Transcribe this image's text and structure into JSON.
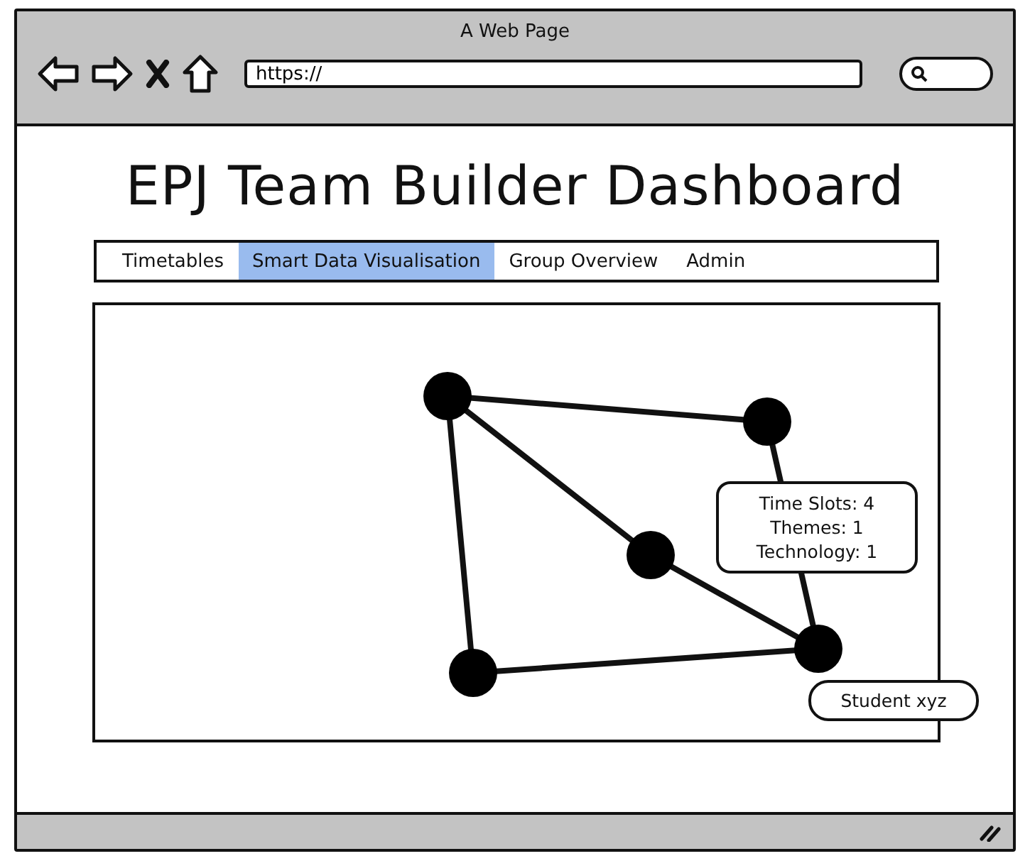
{
  "window": {
    "title": "A Web Page"
  },
  "address_bar": {
    "value": "https://"
  },
  "page": {
    "title": "EPJ Team Builder Dashboard"
  },
  "tabs": [
    {
      "label": "Timetables",
      "selected": false
    },
    {
      "label": "Smart Data Visualisation",
      "selected": true
    },
    {
      "label": "Group Overview",
      "selected": false
    },
    {
      "label": "Admin",
      "selected": false
    }
  ],
  "graph": {
    "callouts": [
      {
        "kind": "details",
        "lines": [
          "Time Slots: 4",
          "Themes: 1",
          "Technology: 1"
        ]
      },
      {
        "kind": "label",
        "lines": [
          "Student xyz"
        ]
      }
    ]
  }
}
